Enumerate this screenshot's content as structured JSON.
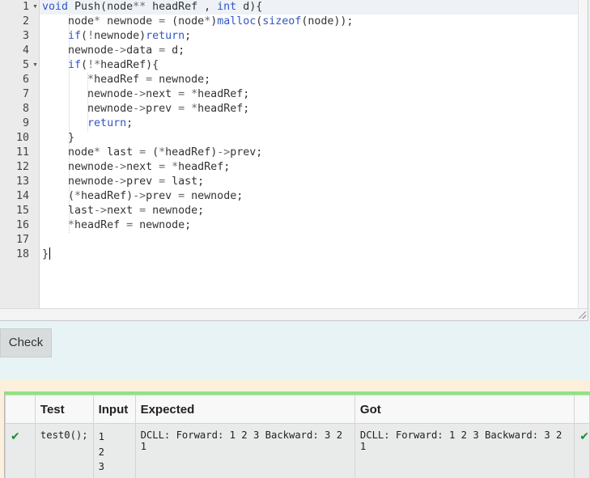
{
  "editor": {
    "lines": [
      {
        "n": "1",
        "fold": true,
        "html": "<span class=\"kw\">void</span> Push(node<span class=\"op\">**</span> headRef , <span class=\"kw\">int</span> d){"
      },
      {
        "n": "2",
        "fold": false,
        "html": "    node<span class=\"op\">*</span> newnode <span class=\"op\">=</span> (node<span class=\"op\">*</span>)<span class=\"kw\">malloc</span>(<span class=\"kw\">sizeof</span>(node));"
      },
      {
        "n": "3",
        "fold": false,
        "html": "    <span class=\"kw\">if</span>(<span class=\"op\">!</span>newnode)<span class=\"kw\">return</span>;"
      },
      {
        "n": "4",
        "fold": false,
        "html": "    newnode<span class=\"op\">-&gt;</span>data <span class=\"op\">=</span> d;"
      },
      {
        "n": "5",
        "fold": true,
        "html": "    <span class=\"kw\">if</span>(<span class=\"op\">!*</span>headRef){"
      },
      {
        "n": "6",
        "fold": false,
        "html": "       <span class=\"op\">*</span>headRef <span class=\"op\">=</span> newnode;"
      },
      {
        "n": "7",
        "fold": false,
        "html": "       newnode<span class=\"op\">-&gt;</span>next <span class=\"op\">=</span> <span class=\"op\">*</span>headRef;"
      },
      {
        "n": "8",
        "fold": false,
        "html": "       newnode<span class=\"op\">-&gt;</span>prev <span class=\"op\">=</span> <span class=\"op\">*</span>headRef;"
      },
      {
        "n": "9",
        "fold": false,
        "html": "       <span class=\"kw\">return</span>;"
      },
      {
        "n": "10",
        "fold": false,
        "html": "    }"
      },
      {
        "n": "11",
        "fold": false,
        "html": "    node<span class=\"op\">*</span> last <span class=\"op\">=</span> (<span class=\"op\">*</span>headRef)<span class=\"op\">-&gt;</span>prev;"
      },
      {
        "n": "12",
        "fold": false,
        "html": "    newnode<span class=\"op\">-&gt;</span>next <span class=\"op\">=</span> <span class=\"op\">*</span>headRef;"
      },
      {
        "n": "13",
        "fold": false,
        "html": "    newnode<span class=\"op\">-&gt;</span>prev <span class=\"op\">=</span> last;"
      },
      {
        "n": "14",
        "fold": false,
        "html": "    (<span class=\"op\">*</span>headRef)<span class=\"op\">-&gt;</span>prev <span class=\"op\">=</span> newnode;"
      },
      {
        "n": "15",
        "fold": false,
        "html": "    last<span class=\"op\">-&gt;</span>next <span class=\"op\">=</span> newnode;"
      },
      {
        "n": "16",
        "fold": false,
        "html": "    <span class=\"op\">*</span>headRef <span class=\"op\">=</span> newnode;"
      },
      {
        "n": "17",
        "fold": false,
        "html": ""
      },
      {
        "n": "18",
        "fold": false,
        "html": "}"
      }
    ]
  },
  "check_button": {
    "label": "Check"
  },
  "results": {
    "headers": {
      "status": "",
      "test": "Test",
      "input": "Input",
      "expected": "Expected",
      "got": "Got",
      "tail": ""
    },
    "rows": [
      {
        "status_icon": "check-icon",
        "test": "test0();",
        "input": [
          "1",
          "2",
          "3"
        ],
        "expected": "DCLL: Forward: 1 2 3 Backward: 3 2 1",
        "got": "DCLL: Forward: 1 2 3 Backward: 3 2 1",
        "tail_icon": "check-icon"
      }
    ]
  },
  "colors": {
    "keyword": "#3256c8",
    "pass_green": "#8ce57f",
    "tick": "#1c8a32"
  }
}
